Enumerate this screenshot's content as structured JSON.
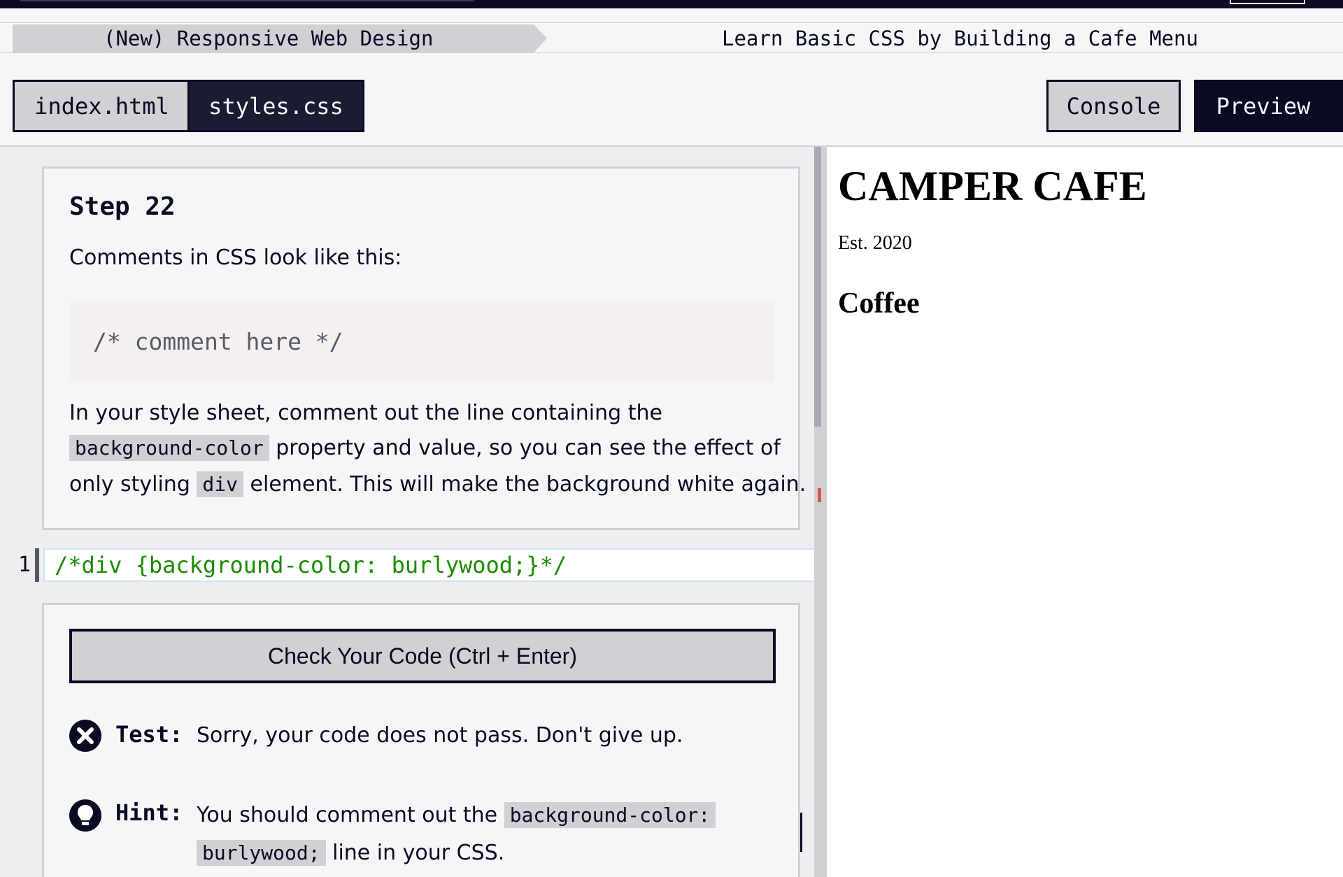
{
  "breadcrumb": {
    "course": "(New) Responsive Web Design",
    "project": "Learn Basic CSS by Building a Cafe Menu"
  },
  "editor_tabs": [
    {
      "label": "index.html",
      "active": false
    },
    {
      "label": "styles.css",
      "active": true
    }
  ],
  "toolbar": {
    "console_label": "Console",
    "preview_label": "Preview"
  },
  "lesson": {
    "step_title": "Step 22",
    "intro": "Comments in CSS look like this:",
    "example_code": "/* comment here */",
    "instruction": {
      "line1": "In your style sheet, comment out the line containing the",
      "code1": "background-color",
      "line2_after": " property and value, so you can see the effect of",
      "line3_before": "only styling ",
      "code2": "div",
      "line3_after": " element. This will make the background white again."
    }
  },
  "editor": {
    "line_number": "1",
    "code": "/*div {background-color: burlywood;}*/"
  },
  "test_panel": {
    "check_button": "Check Your Code (Ctrl + Enter)",
    "test_label": "Test:",
    "test_message": "Sorry, your code does not pass. Don't give up.",
    "hint_label": "Hint:",
    "hint_before": "You should comment out the ",
    "hint_code1": "background-color:",
    "hint_code2": "burlywood;",
    "hint_after": " line in your CSS."
  },
  "preview": {
    "heading": "CAMPER CAFE",
    "est": "Est. 2020",
    "section": "Coffee"
  },
  "icons": {
    "fail": "x-circle-icon",
    "hint": "lightbulb-icon"
  },
  "colors": {
    "dark": "#0a0a23",
    "tab_inactive": "#d0d0d5",
    "code_green": "#1a8a00",
    "error_mark": "#e05252"
  }
}
